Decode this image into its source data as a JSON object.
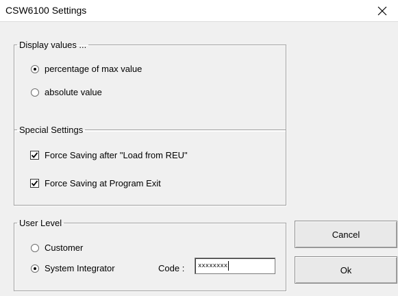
{
  "window": {
    "title": "CSW6100 Settings",
    "close_icon": "close-icon"
  },
  "display_group": {
    "legend": "Display values ...",
    "options": [
      {
        "label": "percentage of max value",
        "selected": true
      },
      {
        "label": "absolute value",
        "selected": false
      }
    ]
  },
  "special_group": {
    "legend": "Special Settings",
    "options": [
      {
        "label": "Force Saving after \"Load from REU\"",
        "checked": true
      },
      {
        "label": "Force Saving at Program Exit",
        "checked": true
      }
    ]
  },
  "user_group": {
    "legend": "User Level",
    "options": [
      {
        "label": "Customer",
        "selected": false
      },
      {
        "label": "System Integrator",
        "selected": true
      }
    ],
    "code_label": "Code :",
    "code_value": "xxxxxxxx"
  },
  "buttons": {
    "cancel": "Cancel",
    "ok": "Ok"
  },
  "colors": {
    "dialog_bg": "#f0f0f0",
    "title_bg": "#ffffff",
    "group_border": "#a0a0a0"
  }
}
